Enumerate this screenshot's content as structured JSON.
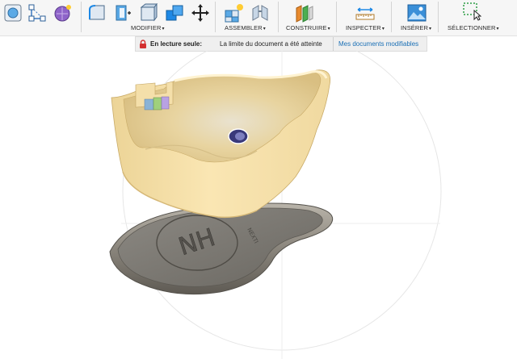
{
  "toolbar": {
    "groups": {
      "modify": "MODIFIER",
      "assemble": "ASSEMBLER",
      "construct": "CONSTRUIRE",
      "inspect": "INSPECTER",
      "insert": "INSÉRER",
      "select": "SÉLECTIONNER"
    },
    "caret": "▾"
  },
  "banner": {
    "readonly_label": "En lecture seule:",
    "message": "La limite du document a été atteinte",
    "link_label": "Mes documents modifiables"
  },
  "model": {
    "base_emboss_text": "NH",
    "base_side_text": "NEXTI"
  },
  "colors": {
    "accent_blue": "#1e88e5",
    "lock_red": "#d32f2f",
    "link_blue": "#1a6fb5",
    "part_yellow": "#f3dba0",
    "base_gray": "#7a7771"
  }
}
